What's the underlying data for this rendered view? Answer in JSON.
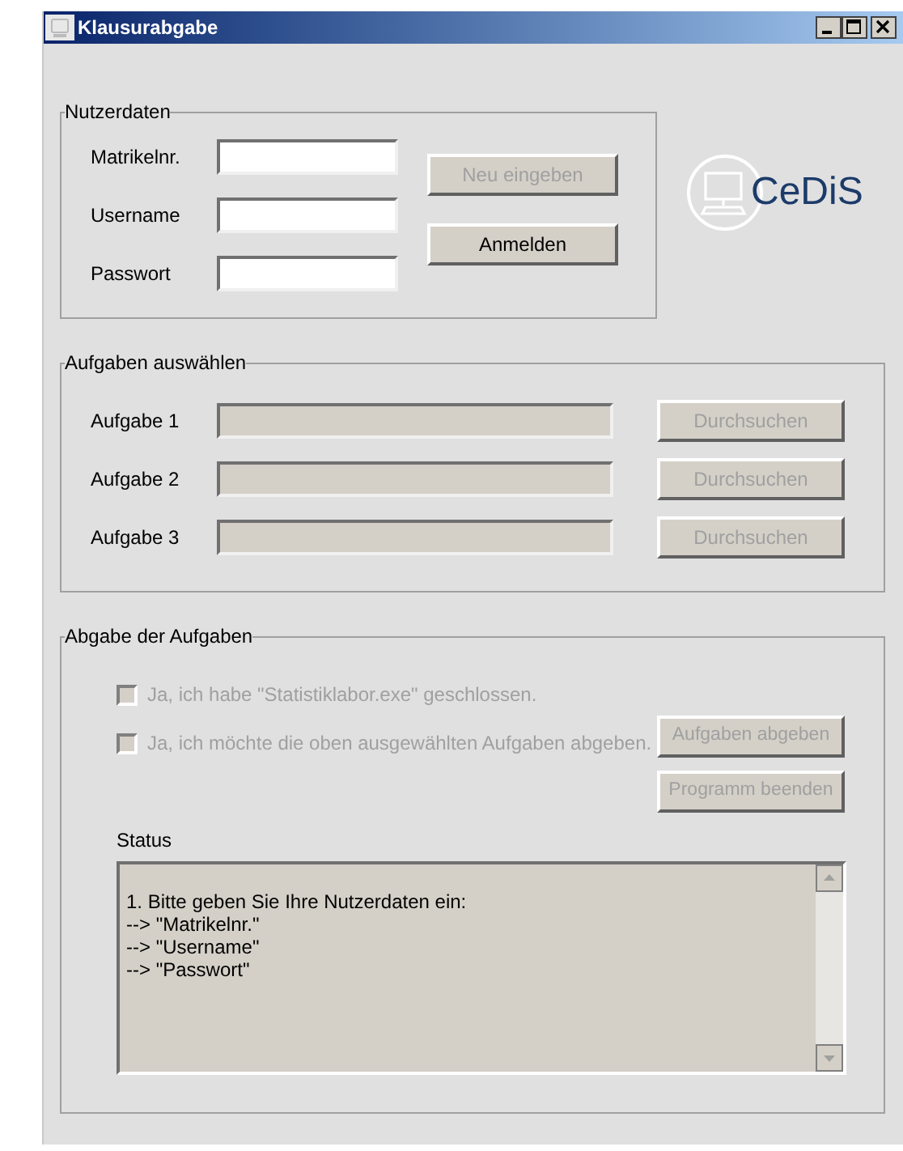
{
  "window": {
    "title": "Klausurabgabe"
  },
  "user_data": {
    "legend": "Nutzerdaten",
    "fields": [
      {
        "label": "Matrikelnr."
      },
      {
        "label": "Username"
      },
      {
        "label": "Passwort"
      }
    ],
    "buttons": [
      {
        "label": "Neu eingeben",
        "disabled": true
      },
      {
        "label": "Anmelden",
        "disabled": false
      }
    ]
  },
  "logo": {
    "text": "CeDiS"
  },
  "tasks": {
    "legend": "Aufgaben auswählen",
    "rows": [
      {
        "label": "Aufgabe 1",
        "disabled": true,
        "button": "Durchsuchen",
        "button_disabled": true
      },
      {
        "label": "Aufgabe 2",
        "disabled": true,
        "button": "Durchsuchen",
        "button_disabled": true
      },
      {
        "label": "Aufgabe 3",
        "disabled": true,
        "button": "Durchsuchen",
        "button_disabled": true
      }
    ]
  },
  "submission": {
    "legend": "Abgabe der Aufgaben",
    "checkboxes": [
      {
        "label": "Ja, ich habe \"Statistiklabor.exe\" geschlossen.",
        "checked": false,
        "disabled": true
      },
      {
        "label": "Ja, ich möchte die oben ausgewählten Aufgaben abgeben.",
        "checked": false,
        "disabled": true
      }
    ],
    "buttons": [
      {
        "label": "Aufgaben abgeben",
        "disabled": true
      },
      {
        "label": "Programm beenden",
        "disabled": true
      }
    ],
    "status_label": "Status",
    "status_lines": [
      "1. Bitte geben Sie Ihre Nutzerdaten ein:",
      "--> \"Matrikelnr.\"",
      "--> \"Username\"",
      "--> \"Passwort\""
    ]
  }
}
